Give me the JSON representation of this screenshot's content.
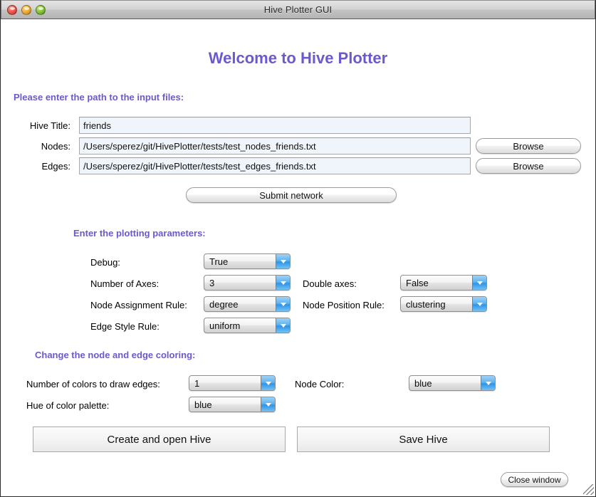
{
  "window": {
    "title": "Hive Plotter GUI",
    "controls": [
      {
        "name": "close",
        "color": "#ef5f52"
      },
      {
        "name": "minimize",
        "color": "#f2b43c"
      },
      {
        "name": "zoom",
        "color": "#8cc63d"
      }
    ]
  },
  "page": {
    "title": "Welcome to Hive Plotter",
    "accent_color": "#6a5acd"
  },
  "paths_section": {
    "heading": "Please enter the path to the input files:",
    "fields": [
      {
        "label": "Hive Title:",
        "value": "friends",
        "placeholder": ""
      },
      {
        "label": "Nodes:",
        "value": "/Users/sperez/git/HivePlotter/tests/test_nodes_friends.txt",
        "placeholder": ""
      },
      {
        "label": "Edges:",
        "value": "/Users/sperez/git/HivePlotter/tests/test_edges_friends.txt",
        "placeholder": ""
      }
    ],
    "browse_nodes_label": "Browse",
    "browse_edges_label": "Browse",
    "submit_label": "Submit network"
  },
  "params_section": {
    "heading": "Enter the plotting parameters:",
    "left": [
      {
        "label": "Debug:",
        "value": "True"
      },
      {
        "label": "Number of Axes:",
        "value": "3"
      },
      {
        "label": "Node Assignment Rule:",
        "value": "degree"
      },
      {
        "label": "Edge Style Rule:",
        "value": "uniform"
      }
    ],
    "right": [
      {
        "label": "Double axes:",
        "value": "False"
      },
      {
        "label": "Node Position Rule:",
        "value": "clustering"
      }
    ]
  },
  "colors_section": {
    "heading": "Change the node and edge coloring:",
    "left": [
      {
        "label": "Number of colors to draw edges:",
        "value": "1"
      },
      {
        "label": "Hue of color palette:",
        "value": "blue"
      }
    ],
    "right": [
      {
        "label": "Node Color:",
        "value": "blue"
      }
    ]
  },
  "actions": {
    "create_label": "Create and open Hive",
    "save_label": "Save Hive",
    "close_label": "Close window"
  }
}
